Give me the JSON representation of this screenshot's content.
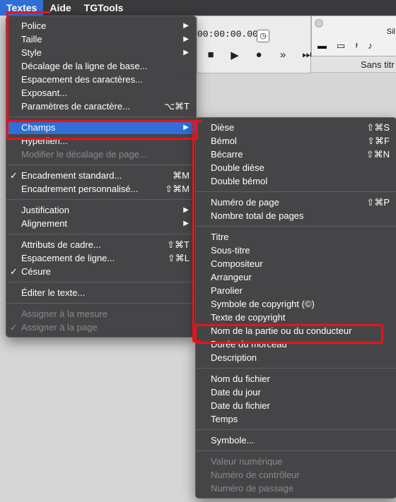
{
  "menubar": {
    "items": [
      "Textes",
      "Aide",
      "TGTools"
    ]
  },
  "background": {
    "timecode": "00:00:00.000",
    "palette_label": "Sil",
    "window_title": "Sans titr"
  },
  "textes_menu": {
    "police": "Police",
    "taille": "Taille",
    "style": "Style",
    "decalage": "Décalage de la ligne de base...",
    "espacement_car": "Espacement des caractères...",
    "exposant": "Exposant...",
    "params_car": "Paramètres de caractère...",
    "params_car_sc": "⌥⌘T",
    "champs": "Champs",
    "hyperlien": "Hyperlien...",
    "modifier_decalage": "Modifier le décalage de page...",
    "encadrement_std": "Encadrement standard...",
    "encadrement_std_sc": "⌘M",
    "encadrement_perso": "Encadrement personnalisé...",
    "encadrement_perso_sc": "⇧⌘M",
    "justification": "Justification",
    "alignement": "Alignement",
    "attributs_cadre": "Attributs de cadre...",
    "attributs_cadre_sc": "⇧⌘T",
    "espacement_ligne": "Espacement de ligne...",
    "espacement_ligne_sc": "⇧⌘L",
    "cesure": "Césure",
    "editer": "Éditer le texte...",
    "assigner_mesure": "Assigner à la mesure",
    "assigner_page": "Assigner à la page"
  },
  "champs_menu": {
    "diese": "Dièse",
    "diese_sc": "⇧⌘S",
    "bemol": "Bémol",
    "bemol_sc": "⇧⌘F",
    "becarre": "Bécarre",
    "becarre_sc": "⇧⌘N",
    "double_diese": "Double dièse",
    "double_bemol": "Double bémol",
    "numero_page": "Numéro de page",
    "numero_page_sc": "⇧⌘P",
    "nombre_pages": "Nombre total de pages",
    "titre": "Titre",
    "sous_titre": "Sous-titre",
    "compositeur": "Compositeur",
    "arrangeur": "Arrangeur",
    "parolier": "Parolier",
    "symbole_copyright": "Symbole de copyright (©)",
    "texte_copyright": "Texte de copyright",
    "nom_partie": "Nom de la partie ou du conducteur",
    "duree": "Durée du morceau",
    "description": "Description",
    "nom_fichier": "Nom du fichier",
    "date_jour": "Date du jour",
    "date_fichier": "Date du fichier",
    "temps": "Temps",
    "symbole": "Symbole...",
    "valeur_numerique": "Valeur numérique",
    "numero_controleur": "Numéro de contrôleur",
    "numero_passage": "Numéro de passage"
  }
}
